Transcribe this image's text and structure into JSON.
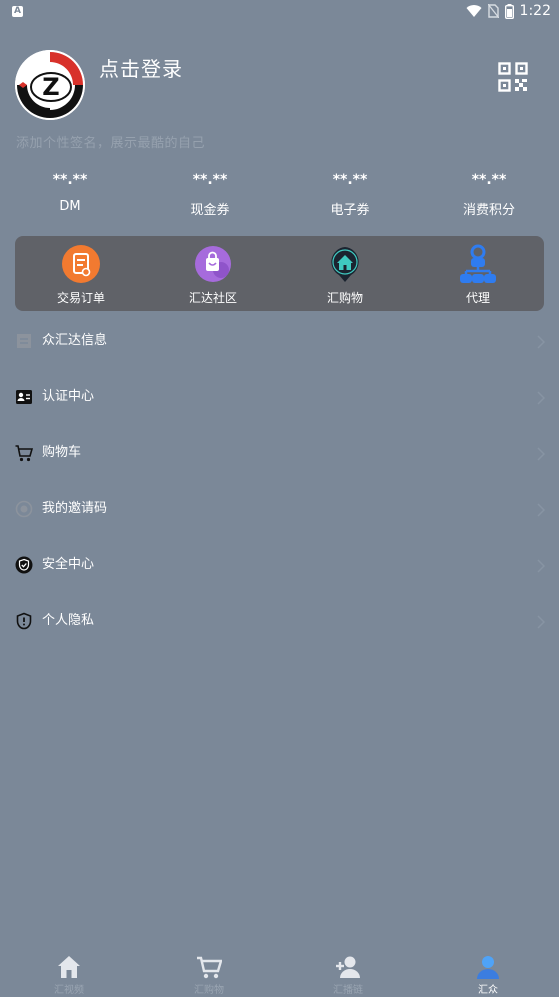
{
  "status_bar": {
    "notification_badge": "A",
    "time": "1:22",
    "icons": [
      "wifi-icon",
      "no-sim-icon",
      "battery-icon"
    ]
  },
  "profile": {
    "avatar_letter": "Z",
    "login_label": "点击登录",
    "signature_placeholder": "添加个性签名，展示最酷的自己"
  },
  "stats": [
    {
      "value": "**.**",
      "label": "DM"
    },
    {
      "value": "**.**",
      "label": "现金券"
    },
    {
      "value": "**.**",
      "label": "电子券"
    },
    {
      "value": "**.**",
      "label": "消费积分"
    }
  ],
  "quick_actions": [
    {
      "label": "交易订单",
      "icon": "order-icon"
    },
    {
      "label": "汇达社区",
      "icon": "community-bag-icon"
    },
    {
      "label": "汇购物",
      "icon": "shop-home-icon"
    },
    {
      "label": "代理",
      "icon": "agent-network-icon"
    }
  ],
  "menu": [
    {
      "label": "众汇达信息",
      "icon": "info-icon"
    },
    {
      "label": "认证中心",
      "icon": "id-card-icon"
    },
    {
      "label": "购物车",
      "icon": "cart-icon"
    },
    {
      "label": "我的邀请码",
      "icon": "invite-code-icon"
    },
    {
      "label": "安全中心",
      "icon": "security-check-icon"
    },
    {
      "label": "个人隐私",
      "icon": "privacy-shield-icon"
    }
  ],
  "tabs": [
    {
      "label": "汇视频",
      "icon": "home-icon",
      "active": false
    },
    {
      "label": "汇购物",
      "icon": "cart-icon",
      "active": false
    },
    {
      "label": "汇播链",
      "icon": "add-user-icon",
      "active": false
    },
    {
      "label": "汇众",
      "icon": "user-icon",
      "active": true
    }
  ],
  "colors": {
    "background": "#7b8898",
    "panel": "#606268",
    "active_tab": "#3b7de0",
    "order_orange": "#f27a30",
    "community_purple": "#a66bdc",
    "agent_blue": "#2f7cf0"
  }
}
